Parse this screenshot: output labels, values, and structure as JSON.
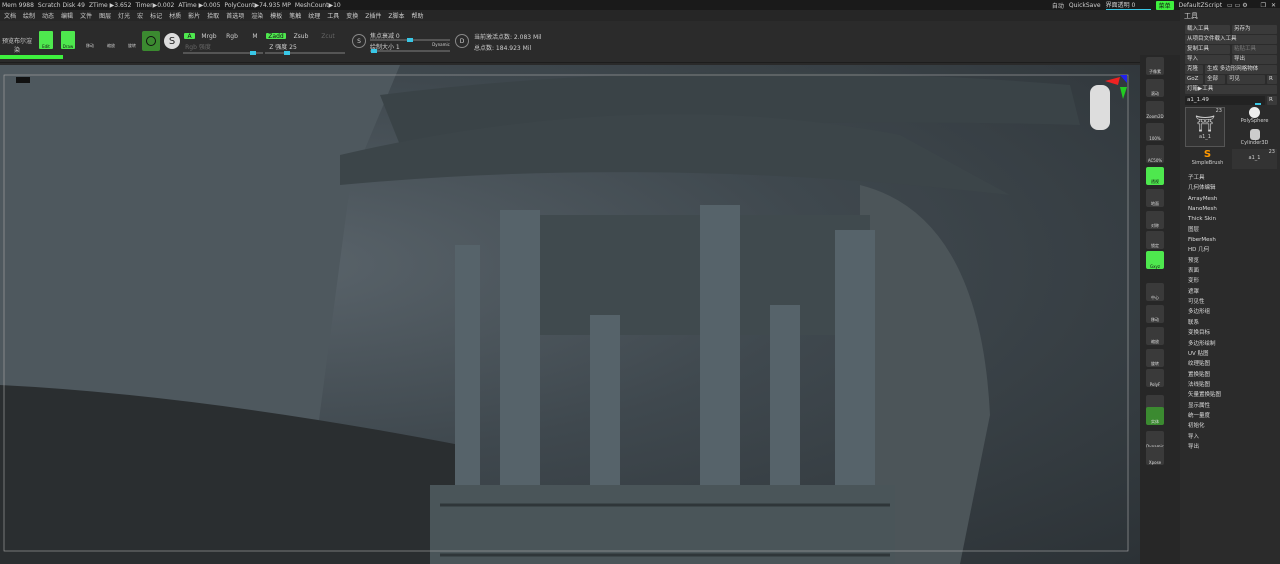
{
  "status": {
    "items": [
      "Mem 9988",
      "Scratch Disk 49",
      "ZTime ▶3.652",
      "Timer▶0.002",
      "ATime ▶0.005",
      "PolyCount▶74.935 MP",
      "MeshCount▶10"
    ],
    "auto": "自动",
    "quicksave": "QuickSave",
    "ui_transparency": "界面透明 0",
    "menus_label": "菜单",
    "script": "DefaultZScript"
  },
  "menu": [
    "文档",
    "绘制",
    "动态",
    "编辑",
    "文件",
    "图层",
    "灯光",
    "宏",
    "标记",
    "材质",
    "影片",
    "拾取",
    "首选项",
    "渲染",
    "模板",
    "笔触",
    "纹理",
    "工具",
    "变换",
    "Z插件",
    "Z脚本",
    "帮助"
  ],
  "toolbar": {
    "bpr": "预览布尔渲染",
    "edit": "Edit",
    "draw": "Draw",
    "move": "移动",
    "scale": "缩放",
    "rotate": "旋转",
    "a": "A",
    "mrgb": "Mrgb",
    "rgb": "Rgb",
    "m": "M",
    "rgb_intensity": "Rgb 强度",
    "zadd": "Zadd",
    "zsub": "Zsub",
    "zcut": "Zcut",
    "z_intensity": "Z 强度 25",
    "focal": "焦点衰减 0",
    "draw_size": "绘制大小 1",
    "dynamic": "Dynamic",
    "active_points": "当前激活点数: 2.083 Mil",
    "total_points": "总点数: 184.923 Mil",
    "ui_transparency_value": 0,
    "rgb_intensity_value": 0.9,
    "z_intensity_value": 0.25,
    "focal_value": 0.5,
    "draw_size_value": 0.01
  },
  "strip": [
    "子像素",
    "滚动",
    "Zoom2D",
    "100%",
    "AC50%",
    "透视",
    "地面",
    "对称",
    "锁定",
    "Gxyz",
    "中心",
    "移动",
    "缩放",
    "旋转",
    "PolyF",
    "透明",
    "实体",
    "Dynamic",
    "Xpose"
  ],
  "panel": {
    "title": "工具",
    "load": "载入工具",
    "save_as": "另存为",
    "load_project": "从项目文件载入工具",
    "copy": "复制工具",
    "paste": "粘贴工具",
    "import": "导入",
    "export": "导出",
    "clone": "克隆",
    "make_polymesh": "生成 多边形网格物体",
    "goz": "GoZ",
    "all": "全部",
    "visible": "可见",
    "r": "R",
    "lightbox": "灯箱▶工具",
    "current_tool": "a1_1.49",
    "slider_value": 0.95,
    "tools": [
      {
        "name": "a1_1",
        "count": "23"
      },
      {
        "name": "PolySphere"
      },
      {
        "name": "Cylinder3D"
      },
      {
        "name": "SimpleBrush"
      },
      {
        "name": "a1_1",
        "count": "23"
      }
    ],
    "sections": [
      "子工具",
      "几何体编辑",
      "ArrayMesh",
      "NanoMesh",
      "Thick Skin",
      "图层",
      "FiberMesh",
      "HD 几何",
      "预览",
      "表面",
      "变形",
      "遮罩",
      "可见性",
      "多边形组",
      "联系",
      "变换目标",
      "多边形绘制",
      "UV 贴图",
      "纹理贴图",
      "置换贴图",
      "法线贴图",
      "矢量置换贴图",
      "显示属性",
      "统一量度",
      "初始化",
      "导入",
      "导出"
    ]
  }
}
